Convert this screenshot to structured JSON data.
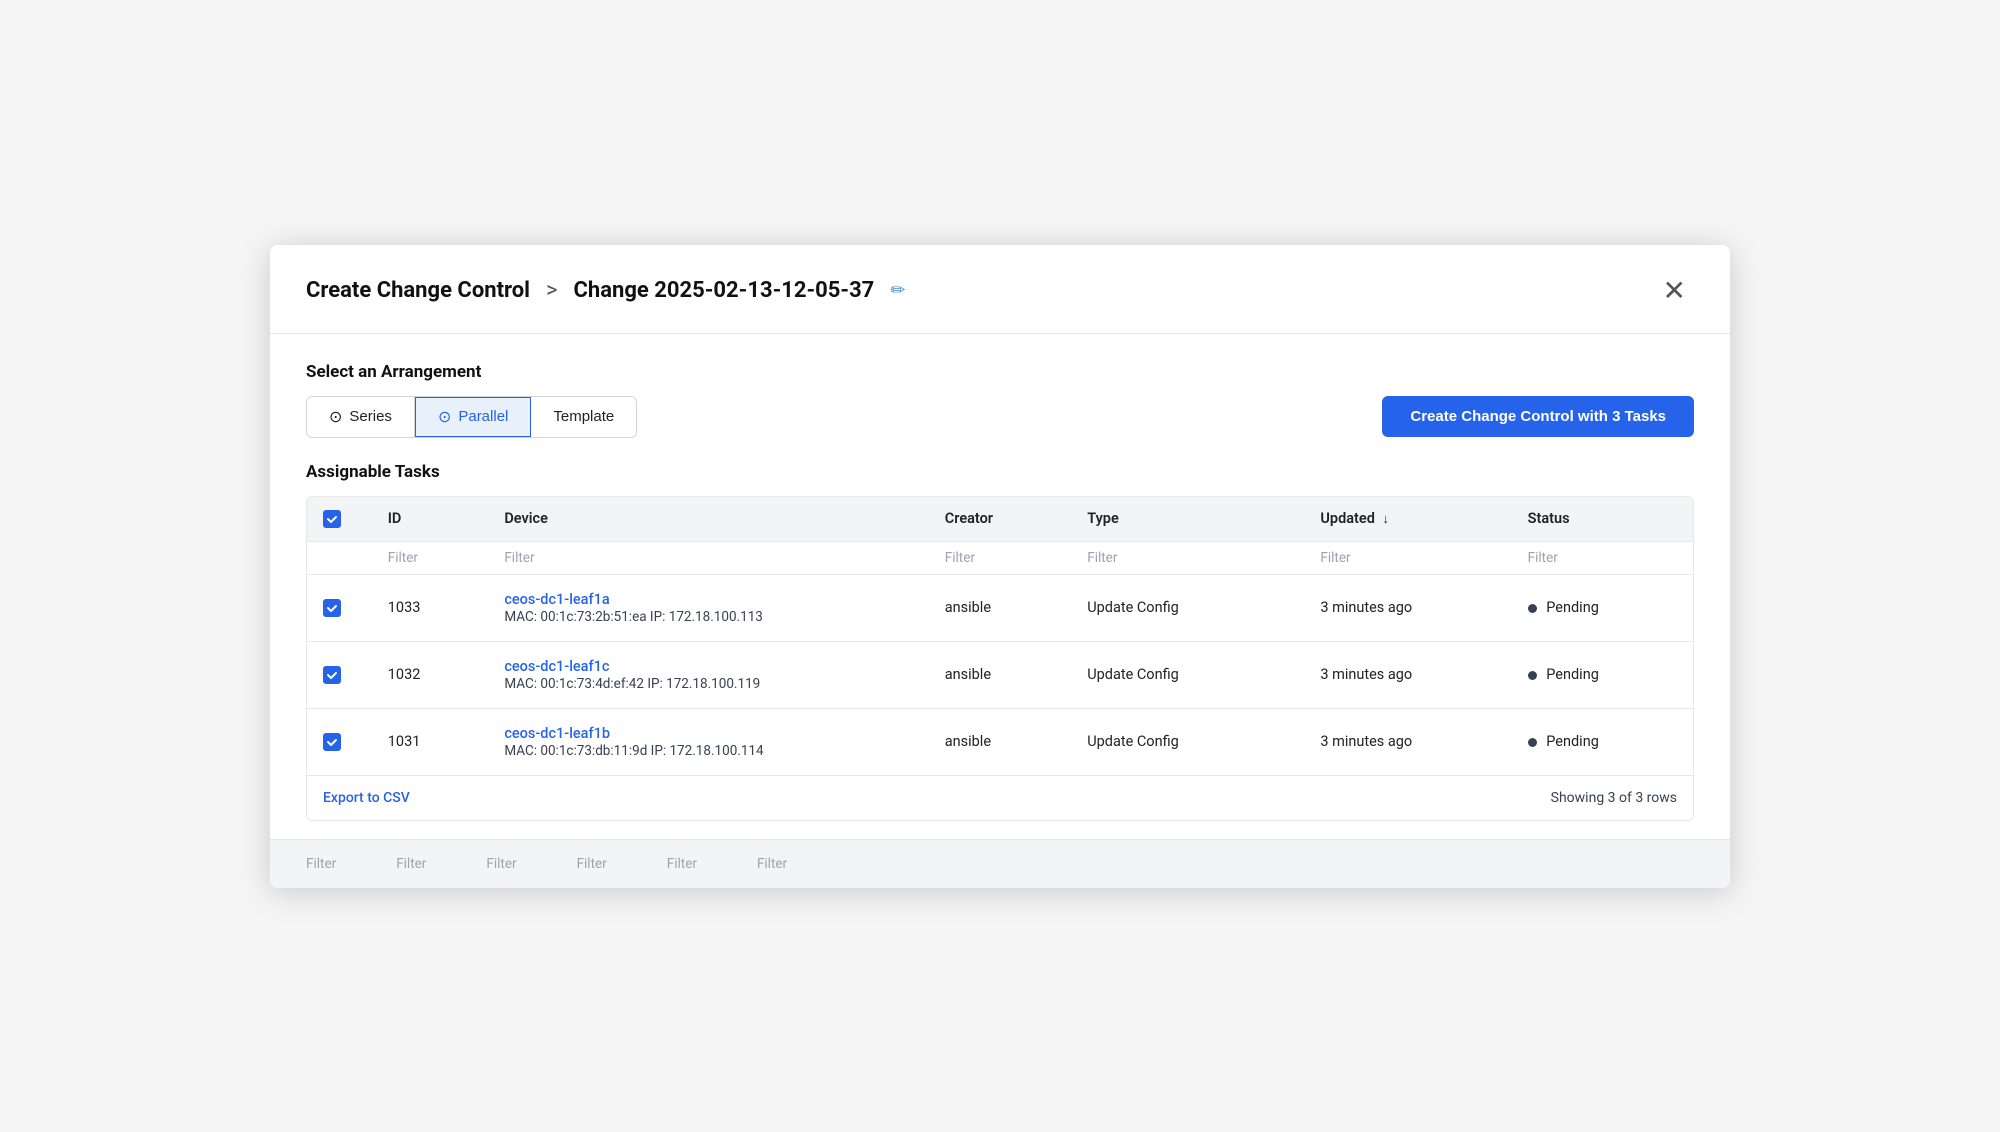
{
  "header": {
    "title": "Create Change Control",
    "separator": ">",
    "change_id": "Change 2025-02-13-12-05-37",
    "edit_icon": "✏",
    "close_icon": "✕"
  },
  "arrangement": {
    "label": "Select an Arrangement",
    "tabs": [
      {
        "id": "series",
        "label": "Series",
        "icon": "⊙",
        "active": false
      },
      {
        "id": "parallel",
        "label": "Parallel",
        "icon": "⊙",
        "active": true
      },
      {
        "id": "template",
        "label": "Template",
        "icon": "",
        "active": false
      }
    ],
    "create_button": "Create Change Control with 3 Tasks"
  },
  "tasks": {
    "label": "Assignable Tasks",
    "columns": [
      {
        "id": "checkbox",
        "label": ""
      },
      {
        "id": "id",
        "label": "ID"
      },
      {
        "id": "device",
        "label": "Device"
      },
      {
        "id": "creator",
        "label": "Creator"
      },
      {
        "id": "type",
        "label": "Type"
      },
      {
        "id": "updated",
        "label": "Updated",
        "sortable": true
      },
      {
        "id": "status",
        "label": "Status"
      }
    ],
    "filters": [
      "Filter",
      "Filter",
      "Filter",
      "Filter",
      "Filter",
      "Filter"
    ],
    "rows": [
      {
        "checked": true,
        "id": "1033",
        "device_name": "ceos-dc1-leaf1a",
        "device_mac": "MAC: 00:1c:73:2b:51:ea IP: 172.18.100.113",
        "creator": "ansible",
        "type": "Update Config",
        "updated": "3 minutes ago",
        "status": "Pending"
      },
      {
        "checked": true,
        "id": "1032",
        "device_name": "ceos-dc1-leaf1c",
        "device_mac": "MAC: 00:1c:73:4d:ef:42 IP: 172.18.100.119",
        "creator": "ansible",
        "type": "Update Config",
        "updated": "3 minutes ago",
        "status": "Pending"
      },
      {
        "checked": true,
        "id": "1031",
        "device_name": "ceos-dc1-leaf1b",
        "device_mac": "MAC: 00:1c:73:db:11:9d IP: 172.18.100.114",
        "creator": "ansible",
        "type": "Update Config",
        "updated": "3 minutes ago",
        "status": "Pending"
      }
    ],
    "footer": {
      "export_label": "Export to CSV",
      "row_count": "Showing 3 of 3 rows"
    }
  },
  "bottom_filters": [
    "Filter",
    "Filter",
    "Filter",
    "Filter",
    "Filter",
    "Filter"
  ]
}
